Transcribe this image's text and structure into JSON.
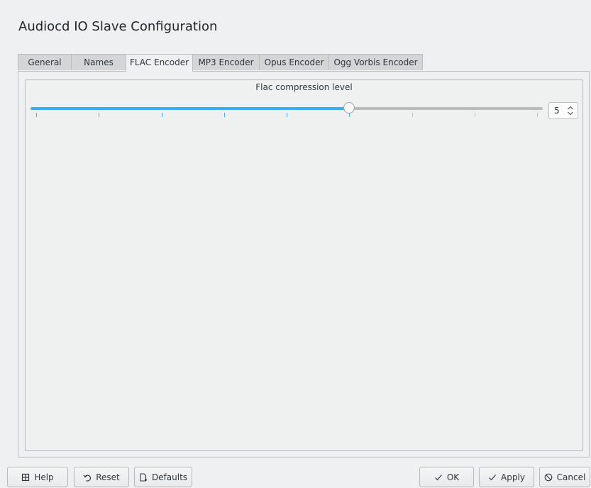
{
  "dialog": {
    "title": "Audiocd IO Slave Configuration"
  },
  "tabs": [
    {
      "label": "General",
      "active": false
    },
    {
      "label": "Names",
      "active": false
    },
    {
      "label": "FLAC Encoder",
      "active": true
    },
    {
      "label": "MP3 Encoder",
      "active": false
    },
    {
      "label": "Opus Encoder",
      "active": false
    },
    {
      "label": "Ogg Vorbis Encoder",
      "active": false
    }
  ],
  "flac": {
    "group_label": "Flac compression level",
    "level": {
      "min": 0,
      "max": 8,
      "value": 5,
      "value_text": "5"
    }
  },
  "buttons": {
    "help": {
      "label": "Help",
      "icon": "help-book-icon"
    },
    "reset": {
      "label": "Reset",
      "icon": "undo-icon"
    },
    "defaults": {
      "label": "Defaults",
      "icon": "document-defaults-icon"
    },
    "ok": {
      "label": "OK",
      "icon": "check-icon"
    },
    "apply": {
      "label": "Apply",
      "icon": "check-icon"
    },
    "cancel": {
      "label": "Cancel",
      "icon": "cancel-circle-icon"
    }
  },
  "colors": {
    "accent": "#3daee9",
    "window_bg": "#eff0f1",
    "text": "#31363b"
  }
}
